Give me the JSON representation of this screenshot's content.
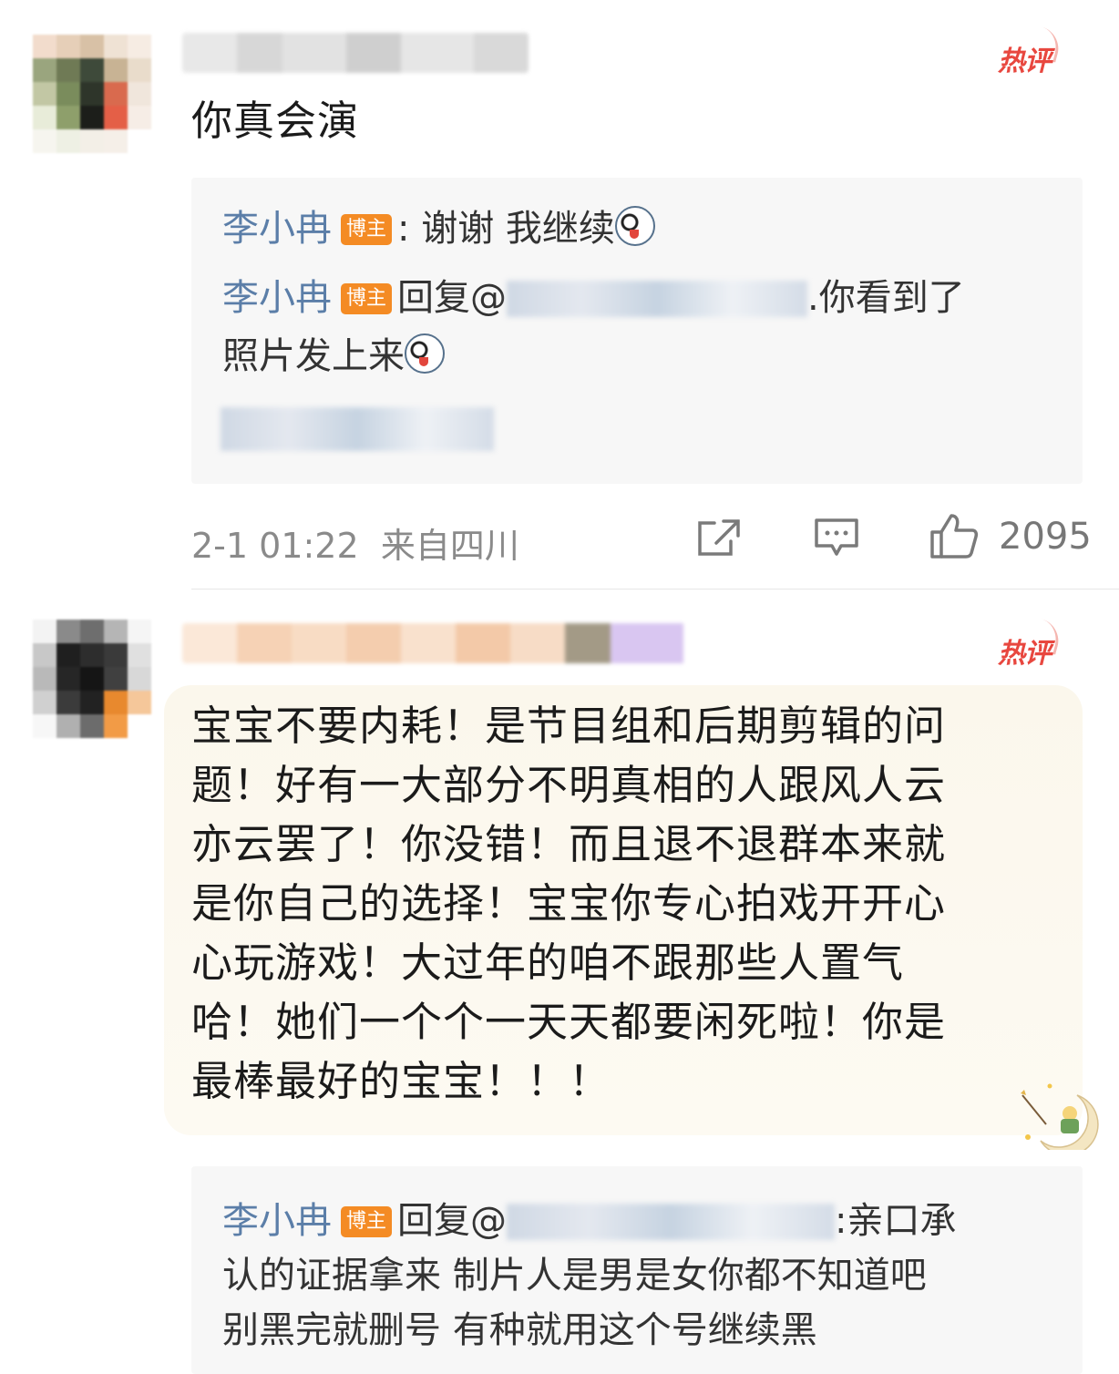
{
  "comments": [
    {
      "hot_label": "热评",
      "text": "你真会演",
      "replies": [
        {
          "author": "李小冉",
          "badge": "博主",
          "text_before": ": 谢谢 我继续"
        },
        {
          "author": "李小冉",
          "badge": "博主",
          "text_before": "回复@",
          "text_after": ".你看到了",
          "line2": "照片发上来"
        }
      ],
      "meta": "2-1 01:22  来自四川",
      "likes": "2095"
    },
    {
      "hot_label": "热评",
      "text_lines": [
        "宝宝不要内耗！是节目组和后期剪辑的问",
        "题！好有一大部分不明真相的人跟风人云",
        "亦云罢了！你没错！而且退不退群本来就",
        "是你自己的选择！宝宝你专心拍戏开开心",
        "心玩游戏！大过年的咱不跟那些人置气",
        "哈！她们一个个一天天都要闲死啦！你是",
        "最棒最好的宝宝！！！"
      ],
      "reply": {
        "author": "李小冉",
        "badge": "博主",
        "text_before": "回复@",
        "text_after": ":亲口承",
        "line2": "认的证据拿来 制片人是男是女你都不知道吧",
        "line3": "别黑完就删号 有种就用这个号继续黑"
      }
    }
  ],
  "icons": [
    "share-icon",
    "comment-icon",
    "like-icon",
    "hot-comment-badge",
    "husky-emoji"
  ]
}
